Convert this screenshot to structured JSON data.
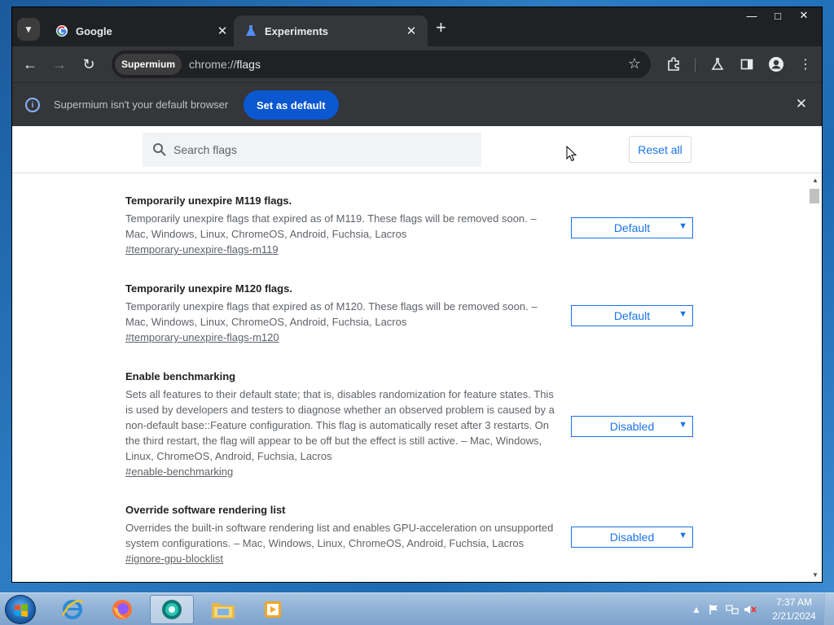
{
  "browser": {
    "tabs": [
      {
        "title": "Google",
        "favicon": "google-g-icon",
        "active": false
      },
      {
        "title": "Experiments",
        "favicon": "flask-icon",
        "active": true
      }
    ],
    "window_controls": [
      "minimize",
      "maximize",
      "close"
    ],
    "profile_chip": "Supermium",
    "url_scheme": "chrome://",
    "url_host": "flags"
  },
  "infobar": {
    "message": "Supermium isn't your default browser",
    "button_label": "Set as default"
  },
  "flags_page": {
    "search_placeholder": "Search flags",
    "reset_label": "Reset all",
    "flags": [
      {
        "name": "Temporarily unexpire M119 flags.",
        "description": "Temporarily unexpire flags that expired as of M119. These flags will be removed soon. – Mac, Windows, Linux, ChromeOS, Android, Fuchsia, Lacros",
        "anchor": "#temporary-unexpire-flags-m119",
        "value": "Default"
      },
      {
        "name": "Temporarily unexpire M120 flags.",
        "description": "Temporarily unexpire flags that expired as of M120. These flags will be removed soon. – Mac, Windows, Linux, ChromeOS, Android, Fuchsia, Lacros",
        "anchor": "#temporary-unexpire-flags-m120",
        "value": "Default"
      },
      {
        "name": "Enable benchmarking",
        "description": "Sets all features to their default state; that is, disables randomization for feature states. This is used by developers and testers to diagnose whether an observed problem is caused by a non-default base::Feature configuration. This flag is automatically reset after 3 restarts. On the third restart, the flag will appear to be off but the effect is still active. – Mac, Windows, Linux, ChromeOS, Android, Fuchsia, Lacros",
        "anchor": "#enable-benchmarking",
        "value": "Disabled"
      },
      {
        "name": "Override software rendering list",
        "description": "Overrides the built-in software rendering list and enables GPU-acceleration on unsupported system configurations. – Mac, Windows, Linux, ChromeOS, Android, Fuchsia, Lacros",
        "anchor": "#ignore-gpu-blocklist",
        "value": "Disabled"
      }
    ]
  },
  "taskbar": {
    "apps": [
      "internet-explorer-icon",
      "firefox-icon",
      "supermium-icon",
      "file-explorer-icon",
      "media-player-icon"
    ],
    "clock_time": "7:37 AM",
    "clock_date": "2/21/2024"
  },
  "colors": {
    "accent": "#1a73e8",
    "infobar_button": "#0b57d0",
    "browser_frame": "#202124",
    "toolbar": "#35363a"
  }
}
